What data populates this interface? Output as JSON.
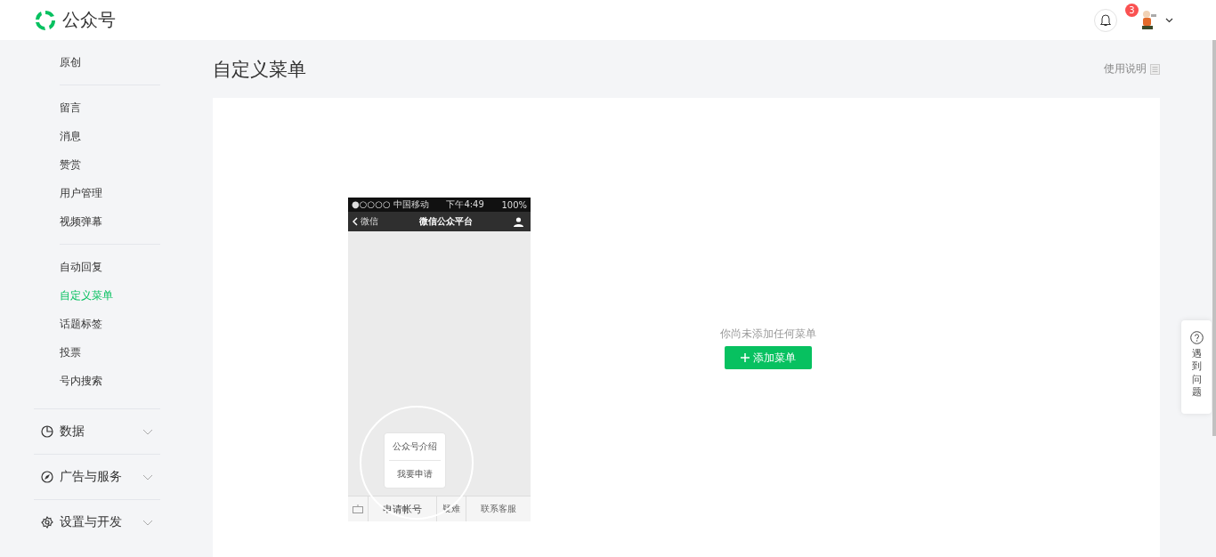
{
  "header": {
    "logo_text": "公众号",
    "notifications": {
      "count": "3"
    }
  },
  "sidebar": {
    "groups": [
      {
        "items": [
          {
            "label": "原创",
            "selected": false
          }
        ]
      },
      {
        "items": [
          {
            "label": "留言",
            "selected": false
          },
          {
            "label": "消息",
            "selected": false
          },
          {
            "label": "赞赏",
            "selected": false
          },
          {
            "label": "用户管理",
            "selected": false
          },
          {
            "label": "视频弹幕",
            "selected": false
          }
        ]
      },
      {
        "items": [
          {
            "label": "自动回复",
            "selected": false
          },
          {
            "label": "自定义菜单",
            "selected": true
          },
          {
            "label": "话题标签",
            "selected": false
          },
          {
            "label": "投票",
            "selected": false
          },
          {
            "label": "号内搜索",
            "selected": false
          }
        ]
      }
    ],
    "sections": [
      {
        "label": "数据",
        "kind": "chart",
        "expanded": false
      },
      {
        "label": "广告与服务",
        "kind": "compass",
        "expanded": false
      },
      {
        "label": "设置与开发",
        "kind": "gear",
        "expanded": false
      }
    ]
  },
  "page": {
    "title": "自定义菜单",
    "help_link": "使用说明"
  },
  "phone": {
    "carrier": "●○○○○ 中国移动",
    "time": "下午4:49",
    "battery": "100%",
    "back": "微信",
    "title": "微信公众平台",
    "popup": [
      "公众号介绍",
      "我要申请"
    ],
    "menu": [
      "申请帐号",
      "疑难",
      "联系客服"
    ]
  },
  "empty_state": {
    "message": "你尚未添加任何菜单",
    "button": "添加菜单"
  },
  "help_float": {
    "label": "遇到问题"
  }
}
